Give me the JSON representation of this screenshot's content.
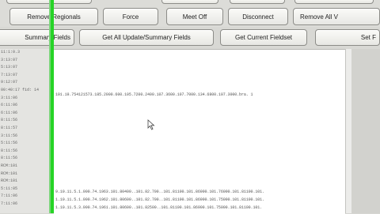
{
  "toolbar_top": {
    "btn_remove_regionals": "Remove Regionals",
    "btn_force": "Force",
    "btn_meet_off": "Meet Off",
    "btn_disconnect": "Disconnect",
    "btn_remove_all": "Remove All V"
  },
  "toolbar_second": {
    "btn_summary_fields": "Summary Fields",
    "btn_get_all_update_summary": "Get All Update/Summary Fields",
    "btn_get_current_fieldset": "Get Current Fieldset",
    "btn_set": "Set F"
  },
  "left_log": [
    "11:1:0.3",
    "3:13:07",
    "5:13:07",
    "7:13:07",
    "9:12:07",
    "00:40:17 fid: 14",
    "3:11:06",
    "6:11:06",
    "6:11:06",
    "8:11:56",
    "8:11:57",
    "3:11:56",
    "5:11:56",
    "8:11:56",
    "8:11:56",
    "RCM:101",
    "RCM:101",
    "RCM:101",
    "5:11:05",
    "7:11:06",
    "7:11:06"
  ],
  "main_log": [
    "101.19.754121573.185.2000.600.105.7200.2400.107.3600.107.7000.134.6800.107.3000.bra. 1",
    "9.10.11.5.1.000.74.1963.101.80400..101.82.700..101.81100.101.86900.101.76000.101.81100.101.",
    "1.10.11.5.1.000.74.1962.101.80600..101.82.700..101.81100.101.86900.101.75000.101.81100.101.",
    "1.10.11.5.3.000.74.1961.101.80600..101.82500..101.81100.101.86900.101.75000.101.81100.101."
  ]
}
